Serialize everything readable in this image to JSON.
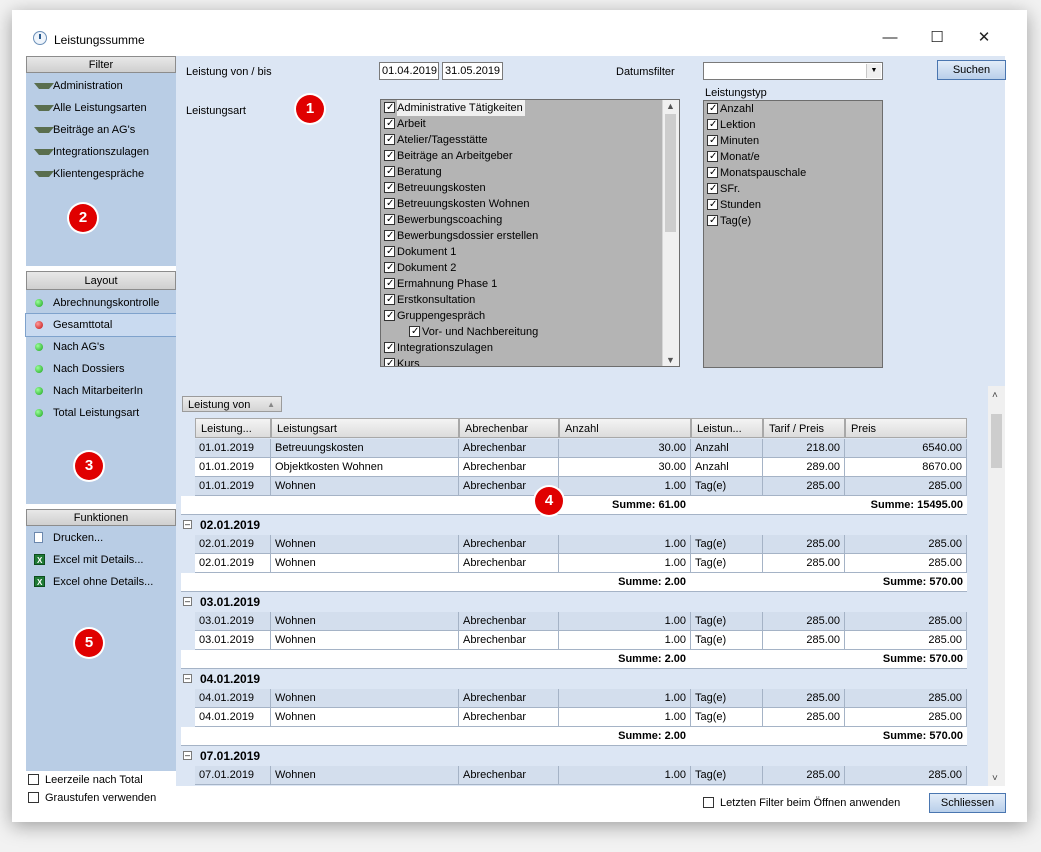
{
  "window": {
    "title": "Leistungssumme",
    "minimize": "—",
    "maximize": "☐",
    "close": "✕"
  },
  "sidebar": {
    "filter": {
      "title": "Filter",
      "items": [
        "Administration",
        "Alle Leistungsarten",
        "Beiträge an AG's",
        "Integrationszulagen",
        "Klientengespräche"
      ]
    },
    "layout": {
      "title": "Layout",
      "items": [
        "Abrechnungskontrolle",
        "Gesamttotal",
        "Nach AG's",
        "Nach Dossiers",
        "Nach MitarbeiterIn",
        "Total Leistungsart"
      ],
      "selected": "Gesamttotal"
    },
    "funktionen": {
      "title": "Funktionen",
      "items": [
        "Drucken...",
        "Excel mit Details...",
        "Excel ohne Details..."
      ]
    },
    "options": {
      "leerzeile": "Leerzeile nach Total",
      "graustufen": "Graustufen verwenden"
    }
  },
  "filters": {
    "date_label": "Leistung von / bis",
    "date_from": "01.04.2019",
    "date_to": "31.05.2019",
    "datumsfilter_label": "Datumsfilter",
    "datumsfilter_value": "",
    "search_button": "Suchen",
    "leistungsart_label": "Leistungsart",
    "leistungsart_items": [
      {
        "label": "Administrative Tätigkeiten",
        "checked": true,
        "indent": 0
      },
      {
        "label": "Arbeit",
        "checked": true,
        "indent": 0
      },
      {
        "label": "Atelier/Tagesstätte",
        "checked": true,
        "indent": 0
      },
      {
        "label": "Beiträge an Arbeitgeber",
        "checked": true,
        "indent": 0
      },
      {
        "label": "Beratung",
        "checked": true,
        "indent": 0
      },
      {
        "label": "Betreuungskosten",
        "checked": true,
        "indent": 0
      },
      {
        "label": "Betreuungskosten Wohnen",
        "checked": true,
        "indent": 0
      },
      {
        "label": "Bewerbungscoaching",
        "checked": true,
        "indent": 0
      },
      {
        "label": "Bewerbungsdossier erstellen",
        "checked": true,
        "indent": 0
      },
      {
        "label": "Dokument 1",
        "checked": true,
        "indent": 0
      },
      {
        "label": "Dokument 2",
        "checked": true,
        "indent": 0
      },
      {
        "label": "Ermahnung Phase 1",
        "checked": true,
        "indent": 0
      },
      {
        "label": "Erstkonsultation",
        "checked": true,
        "indent": 0
      },
      {
        "label": "Gruppengespräch",
        "checked": true,
        "indent": 0
      },
      {
        "label": "Vor- und Nachbereitung",
        "checked": true,
        "indent": 1
      },
      {
        "label": "Integrationszulagen",
        "checked": true,
        "indent": 0
      },
      {
        "label": "Kurs",
        "checked": true,
        "indent": 0
      }
    ],
    "leistungstyp_label": "Leistungstyp",
    "leistungstyp_items": [
      "Anzahl",
      "Lektion",
      "Minuten",
      "Monat/e",
      "Monatspauschale",
      "SFr.",
      "Stunden",
      "Tag(e)"
    ]
  },
  "grid": {
    "group_chip": "Leistung von",
    "columns": [
      "Leistung...",
      "Leistungsart",
      "Abrechenbar",
      "Anzahl",
      "Leistun...",
      "Tarif / Preis",
      "Preis"
    ],
    "first_rows": [
      [
        "01.01.2019",
        "Betreuungskosten",
        "Abrechenbar",
        "30.00",
        "Anzahl",
        "218.00",
        "6540.00"
      ],
      [
        "01.01.2019",
        "Objektkosten Wohnen",
        "Abrechenbar",
        "30.00",
        "Anzahl",
        "289.00",
        "8670.00"
      ],
      [
        "01.01.2019",
        "Wohnen",
        "Abrechenbar",
        "1.00",
        "Tag(e)",
        "285.00",
        "285.00"
      ]
    ],
    "first_sum": {
      "anzahl": "Summe: 61.00",
      "preis": "Summe: 15495.00"
    },
    "groups": [
      {
        "date": "02.01.2019",
        "rows": [
          [
            "02.01.2019",
            "Wohnen",
            "Abrechenbar",
            "1.00",
            "Tag(e)",
            "285.00",
            "285.00"
          ],
          [
            "02.01.2019",
            "Wohnen",
            "Abrechenbar",
            "1.00",
            "Tag(e)",
            "285.00",
            "285.00"
          ]
        ],
        "sum_anzahl": "Summe: 2.00",
        "sum_preis": "Summe: 570.00"
      },
      {
        "date": "03.01.2019",
        "rows": [
          [
            "03.01.2019",
            "Wohnen",
            "Abrechenbar",
            "1.00",
            "Tag(e)",
            "285.00",
            "285.00"
          ],
          [
            "03.01.2019",
            "Wohnen",
            "Abrechenbar",
            "1.00",
            "Tag(e)",
            "285.00",
            "285.00"
          ]
        ],
        "sum_anzahl": "Summe: 2.00",
        "sum_preis": "Summe: 570.00"
      },
      {
        "date": "04.01.2019",
        "rows": [
          [
            "04.01.2019",
            "Wohnen",
            "Abrechenbar",
            "1.00",
            "Tag(e)",
            "285.00",
            "285.00"
          ],
          [
            "04.01.2019",
            "Wohnen",
            "Abrechenbar",
            "1.00",
            "Tag(e)",
            "285.00",
            "285.00"
          ]
        ],
        "sum_anzahl": "Summe: 2.00",
        "sum_preis": "Summe: 570.00"
      },
      {
        "date": "07.01.2019",
        "rows": [
          [
            "07.01.2019",
            "Wohnen",
            "Abrechenbar",
            "1.00",
            "Tag(e)",
            "285.00",
            "285.00"
          ]
        ]
      }
    ]
  },
  "footer": {
    "letzten_filter": "Letzten Filter beim Öffnen anwenden",
    "close_button": "Schliessen"
  },
  "badges": [
    "1",
    "2",
    "3",
    "4",
    "5"
  ]
}
